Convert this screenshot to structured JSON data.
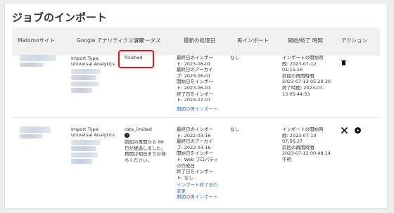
{
  "page": {
    "title": "ジョブのインポート"
  },
  "table": {
    "headers": {
      "site": "Matomoサイト",
      "property": "Google アナリティクス情報",
      "status": "ステータス",
      "last_processed": "最新の処理日",
      "reimport": "再インポート",
      "start_end": "開始/終了 時間",
      "actions": "アクション"
    },
    "rows": [
      {
        "import_type": "Import Type:",
        "import_type_value": "Universal Analytics",
        "status": "finished",
        "last_processed_lines": [
          "最終日のインポー",
          "ト: 2023-06-01",
          "最終日のアーカイ",
          "ブ: 2023-06-01",
          "開始日をインポー",
          "ト: 2023-06-01",
          "終了日をインポー",
          "ト: 2023-07-07"
        ],
        "last_processed_link": "期間の再インポート",
        "reimport": "なし",
        "start_end_lines": [
          "インポートの開始時",
          "間: 2023-07-12",
          "01:15:16",
          "前回の再開時間:",
          "2023-07-13 05:20:30",
          "終了時間: 2023-07-",
          "13 05:44:53"
        ]
      },
      {
        "import_type": "Import Type:",
        "import_type_value": "Universal Analytics",
        "status": "rate_limited",
        "status_note_lines": [
          "前回の再開から 66",
          "日が経過しました。",
          "再開は明日までお待",
          "ちください。"
        ],
        "last_processed_lines": [
          "最終日のインポー",
          "ト: 2022-03-16",
          "最終日のアーカイ",
          "ブ: 2022-03-16",
          "開始日をインポー",
          "ト: Web プロパティ",
          "の作成日",
          "終了日をインポー",
          "ト: なし"
        ],
        "last_processed_links": [
          "インポート終了日の",
          "変更",
          "期間の再インポート"
        ],
        "reimport": "なし",
        "start_end_lines": [
          "インポートの開始時",
          "間: 2023-07-10",
          "07:56:27",
          "前回の再開時間:",
          "2023-07-12 00:48:14",
          "不明"
        ]
      }
    ]
  },
  "icons": {
    "delete": "trash-icon",
    "cancel": "close-icon",
    "resume": "play-circle-icon",
    "info": "info-icon"
  },
  "colors": {
    "highlight": "#e0141a",
    "link": "#3d6fc4"
  }
}
